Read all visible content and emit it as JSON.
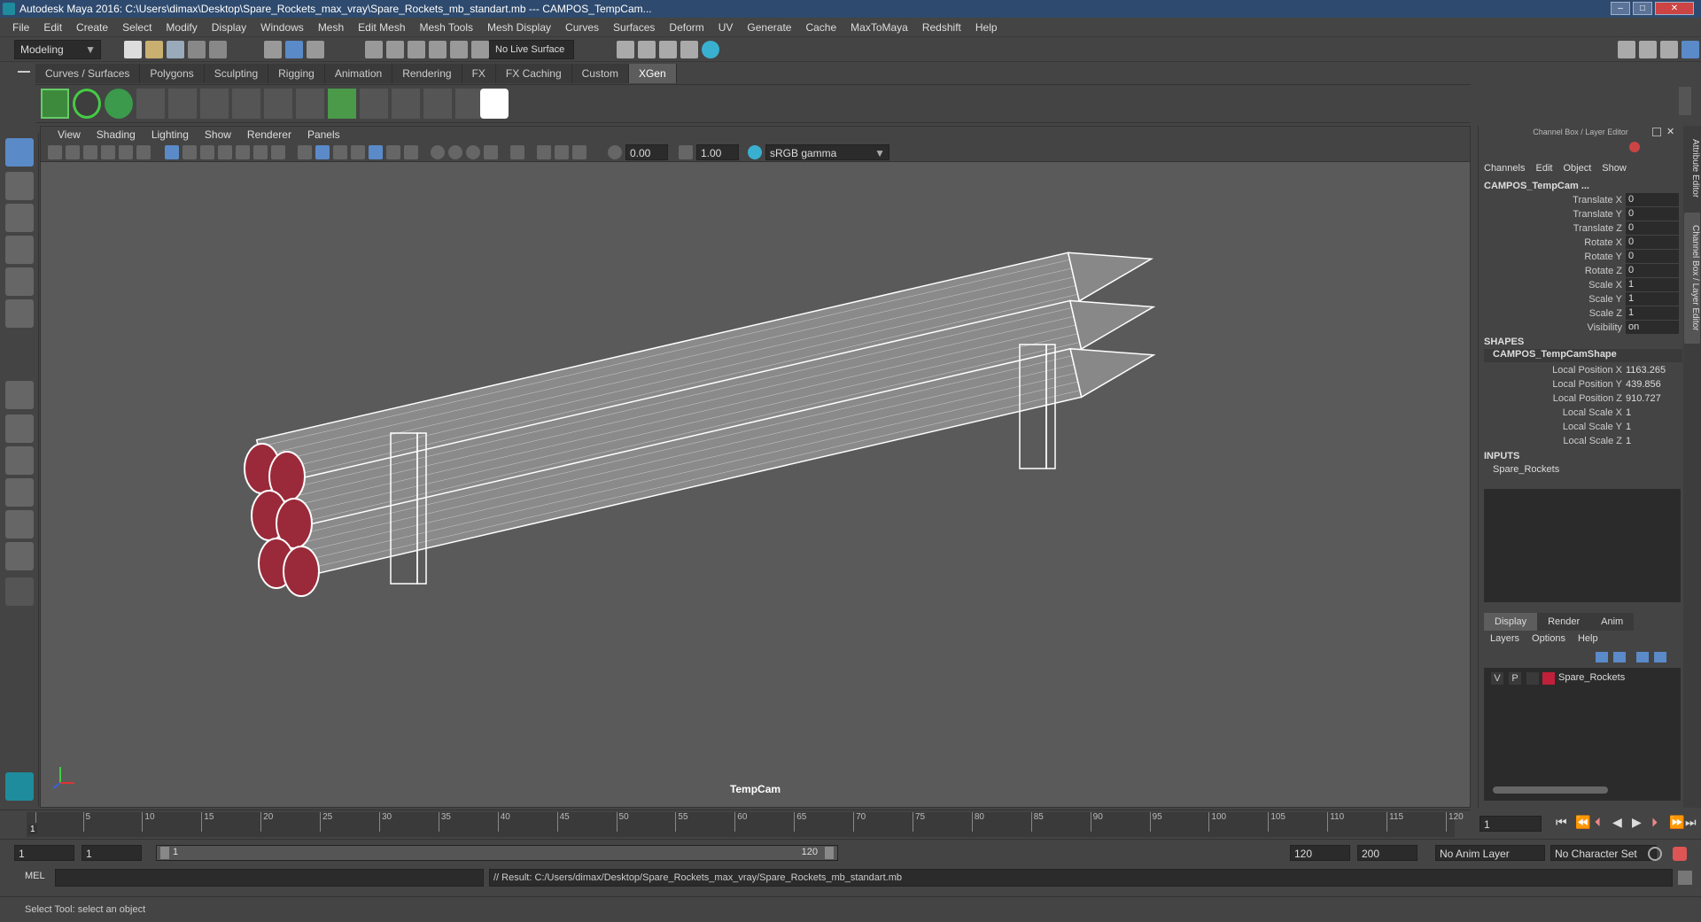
{
  "window": {
    "title": "Autodesk Maya 2016: C:\\Users\\dimax\\Desktop\\Spare_Rockets_max_vray\\Spare_Rockets_mb_standart.mb   ---   CAMPOS_TempCam..."
  },
  "menubar": [
    "File",
    "Edit",
    "Create",
    "Select",
    "Modify",
    "Display",
    "Windows",
    "Mesh",
    "Edit Mesh",
    "Mesh Tools",
    "Mesh Display",
    "Curves",
    "Surfaces",
    "Deform",
    "UV",
    "Generate",
    "Cache",
    "MaxToMaya",
    "Redshift",
    "Help"
  ],
  "statusline": {
    "mode": "Modeling",
    "live_surface": "No Live Surface"
  },
  "shelf_tabs": [
    "Curves / Surfaces",
    "Polygons",
    "Sculpting",
    "Rigging",
    "Animation",
    "Rendering",
    "FX",
    "FX Caching",
    "Custom",
    "XGen"
  ],
  "shelf_active": "XGen",
  "panel": {
    "menu": [
      "View",
      "Shading",
      "Lighting",
      "Show",
      "Renderer",
      "Panels"
    ],
    "exposure": "0.00",
    "gamma": "1.00",
    "color_space": "sRGB gamma",
    "camera_label": "TempCam"
  },
  "channel_box": {
    "header": "Channel Box / Layer Editor",
    "menu": [
      "Channels",
      "Edit",
      "Object",
      "Show"
    ],
    "object_name": "CAMPOS_TempCam ...",
    "channels": [
      {
        "label": "Translate X",
        "value": "0"
      },
      {
        "label": "Translate Y",
        "value": "0"
      },
      {
        "label": "Translate Z",
        "value": "0"
      },
      {
        "label": "Rotate X",
        "value": "0"
      },
      {
        "label": "Rotate Y",
        "value": "0"
      },
      {
        "label": "Rotate Z",
        "value": "0"
      },
      {
        "label": "Scale X",
        "value": "1"
      },
      {
        "label": "Scale Y",
        "value": "1"
      },
      {
        "label": "Scale Z",
        "value": "1"
      },
      {
        "label": "Visibility",
        "value": "on"
      }
    ],
    "shapes_header": "SHAPES",
    "shape_name": "CAMPOS_TempCamShape",
    "shape_channels": [
      {
        "label": "Local Position X",
        "value": "1163.265"
      },
      {
        "label": "Local Position Y",
        "value": "439.856"
      },
      {
        "label": "Local Position Z",
        "value": "910.727"
      },
      {
        "label": "Local Scale X",
        "value": "1"
      },
      {
        "label": "Local Scale Y",
        "value": "1"
      },
      {
        "label": "Local Scale Z",
        "value": "1"
      }
    ],
    "inputs_header": "INPUTS",
    "input_name": "Spare_Rockets"
  },
  "layer_editor": {
    "tabs": [
      "Display",
      "Render",
      "Anim"
    ],
    "active_tab": "Display",
    "menu": [
      "Layers",
      "Options",
      "Help"
    ],
    "layer": {
      "v": "V",
      "p": "P",
      "name": "Spare_Rockets",
      "color": "#c0203a"
    }
  },
  "vertical_tabs": [
    "Attribute Editor",
    "Channel Box / Layer Editor"
  ],
  "timeline": {
    "ticks": [
      "5",
      "10",
      "15",
      "20",
      "25",
      "30",
      "35",
      "40",
      "45",
      "50",
      "55",
      "60",
      "65",
      "70",
      "75",
      "80",
      "85",
      "90",
      "95",
      "100",
      "105",
      "110",
      "115",
      "120"
    ],
    "current_frame_marker": "1",
    "current_frame_field": "1"
  },
  "range": {
    "start": "1",
    "playback_start": "1",
    "slider_start": "1",
    "slider_end": "120",
    "playback_end": "120",
    "end": "200",
    "anim_layer": "No Anim Layer",
    "character_set": "No Character Set"
  },
  "command_line": {
    "label": "MEL",
    "result": "// Result: C:/Users/dimax/Desktop/Spare_Rockets_max_vray/Spare_Rockets_mb_standart.mb"
  },
  "help_line": "Select Tool: select an object"
}
